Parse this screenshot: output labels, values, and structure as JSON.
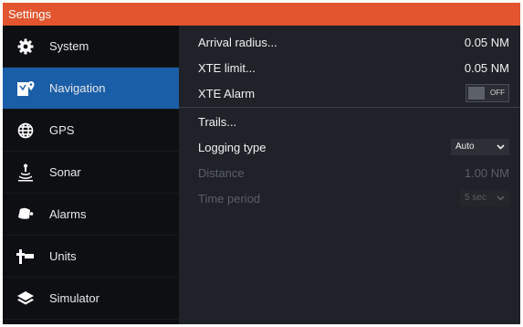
{
  "window": {
    "title": "Settings"
  },
  "sidebar": {
    "items": [
      {
        "label": "System",
        "icon": "gear-icon"
      },
      {
        "label": "Navigation",
        "icon": "navigation-map-icon"
      },
      {
        "label": "GPS",
        "icon": "globe-icon"
      },
      {
        "label": "Sonar",
        "icon": "sonar-icon"
      },
      {
        "label": "Alarms",
        "icon": "alarm-bell-icon"
      },
      {
        "label": "Units",
        "icon": "units-icon"
      },
      {
        "label": "Simulator",
        "icon": "layers-icon"
      }
    ],
    "active_index": 1
  },
  "navigation": {
    "arrival_radius": {
      "label": "Arrival radius...",
      "value": "0.05 NM"
    },
    "xte_limit": {
      "label": "XTE limit...",
      "value": "0.05 NM"
    },
    "xte_alarm": {
      "label": "XTE Alarm",
      "toggle_text": "OFF",
      "enabled": false
    },
    "trails": {
      "label": "Trails..."
    },
    "logging_type": {
      "label": "Logging type",
      "selected": "Auto"
    },
    "distance": {
      "label": "Distance",
      "value": "1.00 NM"
    },
    "time_period": {
      "label": "Time period",
      "selected": "5 sec"
    }
  },
  "colors": {
    "title_bar": "#e2552f",
    "sidebar_bg": "#0d0f12",
    "active_item": "#1a5ea7",
    "content_bg": "#1f2228",
    "disabled_text": "#5a5e66"
  }
}
